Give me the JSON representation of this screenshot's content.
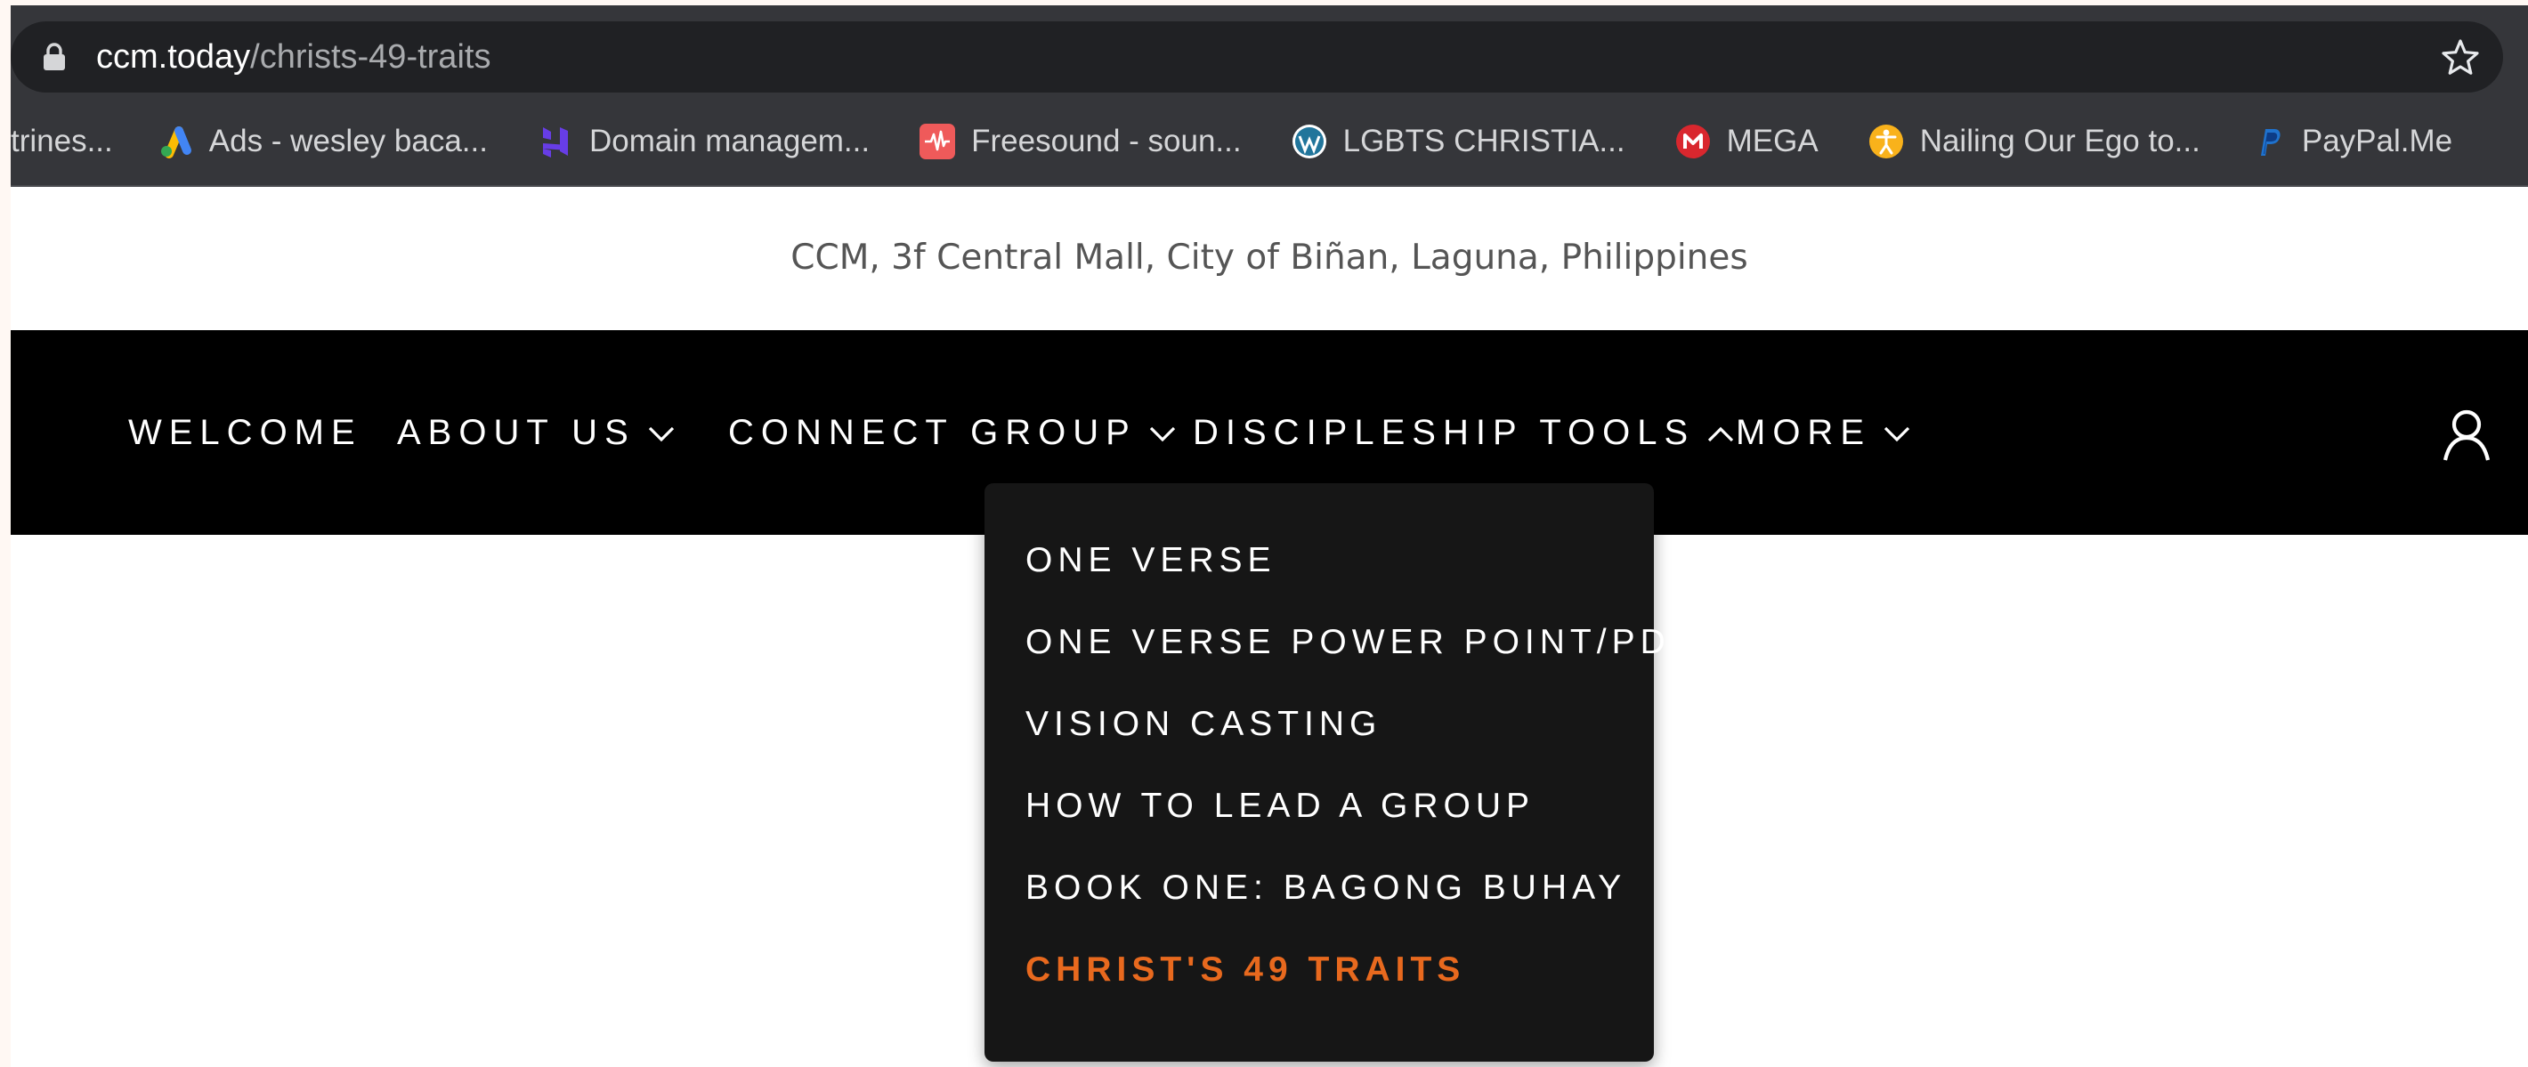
{
  "browser": {
    "url_domain": "ccm.today",
    "url_path": "/christs-49-traits",
    "bookmarks": [
      {
        "label": "trines...",
        "icon": "none"
      },
      {
        "label": "Ads - wesley baca...",
        "icon": "google-ads-icon"
      },
      {
        "label": "Domain managem...",
        "icon": "hostinger-icon"
      },
      {
        "label": "Freesound - soun...",
        "icon": "freesound-icon"
      },
      {
        "label": "LGBTS CHRISTIA...",
        "icon": "wordpress-icon"
      },
      {
        "label": "MEGA",
        "icon": "mega-icon"
      },
      {
        "label": "Nailing Our Ego to...",
        "icon": "accessibility-icon"
      },
      {
        "label": "PayPal.Me",
        "icon": "paypal-icon"
      }
    ]
  },
  "site": {
    "address": "CCM, 3f Central Mall, City of Biñan, Laguna, Philippines",
    "nav": [
      {
        "label": "WELCOME"
      },
      {
        "label": "ABOUT US"
      },
      {
        "label": "CONNECT GROUP"
      },
      {
        "label": "DISCIPLESHIP TOOLS"
      },
      {
        "label": "MORE"
      }
    ],
    "dropdown": [
      {
        "label": "ONE VERSE"
      },
      {
        "label": "ONE VERSE POWER POINT/PDF"
      },
      {
        "label": "VISION CASTING"
      },
      {
        "label": "HOW TO LEAD A GROUP"
      },
      {
        "label": "BOOK ONE: BAGONG BUHAY"
      },
      {
        "label": "CHRIST'S 49 TRAITS",
        "active": true
      }
    ]
  },
  "colors": {
    "chrome_bg": "#35363a",
    "omnibox_bg": "#202124",
    "nav_bg": "#000000",
    "dropdown_bg": "#161616",
    "accent": "#e8691e"
  }
}
